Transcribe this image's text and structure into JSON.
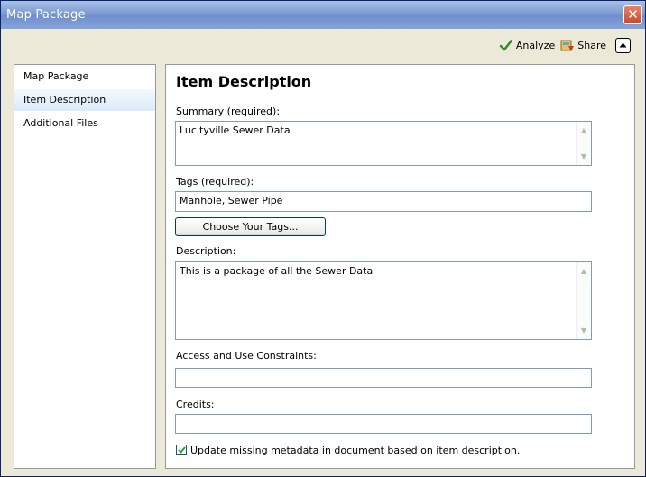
{
  "window": {
    "title": "Map Package",
    "close_symbol": "✕"
  },
  "toolbar": {
    "analyze_label": "Analyze",
    "share_label": "Share"
  },
  "nav": {
    "items": [
      {
        "label": "Map Package"
      },
      {
        "label": "Item Description"
      },
      {
        "label": "Additional Files"
      }
    ],
    "selected_index": 1
  },
  "main": {
    "heading": "Item Description",
    "summary": {
      "label": "Summary (required):",
      "value": "Lucityville Sewer Data"
    },
    "tags": {
      "label": "Tags (required):",
      "value": "Manhole, Sewer Pipe"
    },
    "choose_tags_button": "Choose Your Tags...",
    "description": {
      "label": "Description:",
      "value": "This is a package of all the Sewer Data"
    },
    "access": {
      "label": "Access and Use Constraints:",
      "value": ""
    },
    "credits": {
      "label": "Credits:",
      "value": ""
    },
    "update_metadata": {
      "label": "Update missing metadata in document based on item description.",
      "checked": true
    }
  },
  "colors": {
    "title_bar": "#7C9BD4",
    "window_bg": "#ECE9D8",
    "field_border": "#7F9DB9",
    "selected_item": "#DCEBFA",
    "check_green": "#2E8B2E"
  }
}
